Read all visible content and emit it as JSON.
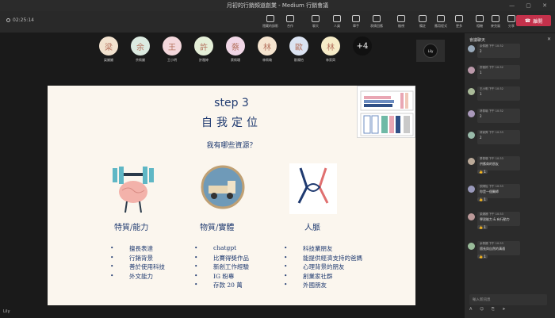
{
  "window": {
    "title": "月初的行銷頻道創業 - Medium 行銷會議"
  },
  "toolbar": {
    "elapsed": "02:25:14",
    "buttons": [
      {
        "label": "隱藏的錄影",
        "icon": "record-icon"
      },
      {
        "label": "合作",
        "icon": "collab-icon"
      },
      {
        "label": "聊天",
        "icon": "chat-icon"
      },
      {
        "label": "人員",
        "icon": "people-icon"
      },
      {
        "label": "舉手",
        "icon": "raise-hand-icon"
      },
      {
        "label": "表情回應",
        "icon": "reaction-icon"
      },
      {
        "label": "檢視",
        "icon": "view-icon"
      },
      {
        "label": "備註",
        "icon": "notes-icon"
      },
      {
        "label": "應用程式",
        "icon": "apps-icon"
      },
      {
        "label": "更多",
        "icon": "more-icon"
      },
      {
        "label": "相機",
        "icon": "camera-icon"
      },
      {
        "label": "麥克風",
        "icon": "mic-icon"
      },
      {
        "label": "分享",
        "icon": "share-icon"
      }
    ],
    "leave_label": "離開"
  },
  "participants": [
    {
      "initial": "梁",
      "name": "梁姍姍",
      "color": "#f2e2cf"
    },
    {
      "initial": "余",
      "name": "余佩姍",
      "color": "#dcebe1"
    },
    {
      "initial": "王",
      "name": "王小明",
      "color": "#f4d8dc"
    },
    {
      "initial": "許",
      "name": "許雅婷",
      "color": "#e5efd8"
    },
    {
      "initial": "蔡",
      "name": "蔡佩珊",
      "color": "#f1d7e6"
    },
    {
      "initial": "林",
      "name": "林佩瑜",
      "color": "#f5e4cf"
    },
    {
      "initial": "歐",
      "name": "歐陽怡",
      "color": "#dbe3f2"
    },
    {
      "initial": "林",
      "name": "林家齊",
      "color": "#f6ecc8"
    },
    {
      "initial": "+4",
      "name": "",
      "color": "#111111"
    }
  ],
  "self_tile": {
    "initial": "Lily"
  },
  "slide": {
    "step": "step 3",
    "title": "自我定位",
    "question": "我有哪些資源？",
    "columns": [
      {
        "heading": "特質/能力",
        "items": [
          "擅長表達",
          "行銷背景",
          "善於使用科技",
          "外文能力"
        ]
      },
      {
        "heading": "物質/實體",
        "items": [
          "chatgpt",
          "比賽得獎作品",
          "新創工作經驗",
          "IG 粉專",
          "存款 20 萬"
        ]
      },
      {
        "heading": "人脈",
        "items": [
          "科技業朋友",
          "能提供經濟支持的爸媽",
          "心理背景的朋友",
          "創業家社群",
          "外國朋友"
        ]
      }
    ]
  },
  "chat": {
    "header": "會議聊天",
    "messages": [
      {
        "who": "余佩姍  下午 10:32",
        "text": "2",
        "react": "",
        "color": "#9ab"
      },
      {
        "who": "許雅婷  下午 10:32",
        "text": "1",
        "react": "",
        "color": "#b9a"
      },
      {
        "who": "王小明  下午 10:32",
        "text": "1",
        "react": "",
        "color": "#ab9"
      },
      {
        "who": "林佩瑜  下午 10:32",
        "text": "2",
        "react": "",
        "color": "#a9b"
      },
      {
        "who": "林家齊  下午 10:33",
        "text": "2",
        "react": "",
        "color": "#9ba"
      },
      {
        "who": "蔡佩珊  下午 10:33",
        "text": "供應商的朋友",
        "react": "👍 1",
        "color": "#ba9"
      },
      {
        "who": "歐陽怡  下午 10:33",
        "text": "你是一個醫師",
        "react": "👍 1",
        "color": "#99b"
      },
      {
        "who": "梁姍姍  下午 10:33",
        "text": "學習能力 & 有行動力",
        "react": "👍 1",
        "color": "#b99"
      },
      {
        "who": "余佩姍  下午 10:33",
        "text": "擅長與自然的溝通",
        "react": "👍 1",
        "color": "#9b9"
      }
    ],
    "compose_placeholder": "輸入新訊息",
    "compose_tools": "A ☺ ⎘ ➤"
  },
  "self_name": "Lily"
}
